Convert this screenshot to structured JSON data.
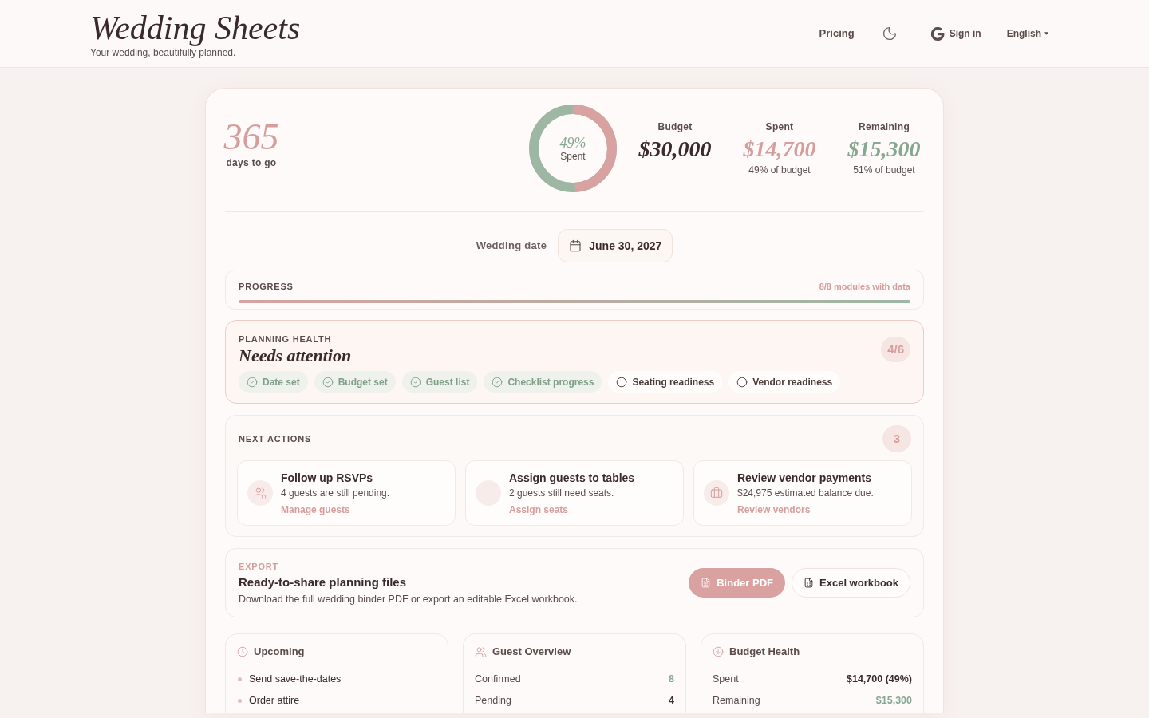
{
  "header": {
    "logo": "Wedding Sheets",
    "tagline": "Your wedding, beautifully planned.",
    "nav": {
      "pricing": "Pricing",
      "sign_in": "Sign in",
      "language": "English"
    }
  },
  "countdown": {
    "value": "365",
    "label": "days to go"
  },
  "spend_ring": {
    "level": 0.49,
    "value": "49%",
    "label": "Spent"
  },
  "budget_stats": [
    {
      "label": "Budget",
      "value": "$30,000",
      "color": "#3b2a2a"
    },
    {
      "label": "Spent",
      "value": "$14,700",
      "note": "49% of budget",
      "color": "#d59e9c"
    },
    {
      "label": "Remaining",
      "value": "$15,300",
      "note": "51% of budget",
      "color": "#86a890"
    }
  ],
  "wedding_date": {
    "label": "Wedding date",
    "value": "June 30, 2027"
  },
  "progress": {
    "title": "PROGRESS",
    "summary": "8/8 modules with data",
    "level": 1
  },
  "planning_health": {
    "title": "PLANNING HEALTH",
    "status": "Needs attention",
    "score": "4/6",
    "checks": [
      {
        "label": "Date set",
        "checked": true
      },
      {
        "label": "Budget set",
        "checked": true
      },
      {
        "label": "Guest list",
        "checked": true
      },
      {
        "label": "Checklist progress",
        "checked": true
      },
      {
        "label": "Seating readiness",
        "checked": false
      },
      {
        "label": "Vendor readiness",
        "checked": false
      }
    ]
  },
  "next_actions": {
    "title": "NEXT ACTIONS",
    "count": "3",
    "items": [
      {
        "title": "Follow up RSVPs",
        "detail": "4 guests are still pending.",
        "link": "Manage guests"
      },
      {
        "title": "Assign guests to tables",
        "detail": "2 guests still need seats.",
        "link": "Assign seats"
      },
      {
        "title": "Review vendor payments",
        "detail": "$24,975 estimated balance due.",
        "link": "Review vendors"
      }
    ]
  },
  "export": {
    "eyebrow": "EXPORT",
    "title": "Ready-to-share planning files",
    "description": "Download the full wedding binder PDF or export an editable Excel workbook.",
    "buttons": [
      {
        "label": "Binder PDF",
        "kind": "primary"
      },
      {
        "label": "Excel workbook",
        "kind": "secondary"
      }
    ]
  },
  "upcoming": {
    "title": "Upcoming",
    "items": [
      "Send save-the-dates",
      "Order attire"
    ]
  },
  "guest_overview": {
    "title": "Guest Overview",
    "rows": [
      {
        "label": "Confirmed",
        "value": "8",
        "color": "#86a890"
      },
      {
        "label": "Pending",
        "value": "4",
        "color": "#3b2a2a"
      }
    ]
  },
  "budget_health": {
    "title": "Budget Health",
    "rows": [
      {
        "label": "Spent",
        "value": "$14,700 (49%)",
        "color": "#3b2a2a"
      },
      {
        "label": "Remaining",
        "value": "$15,300",
        "color": "#86a890"
      }
    ]
  }
}
